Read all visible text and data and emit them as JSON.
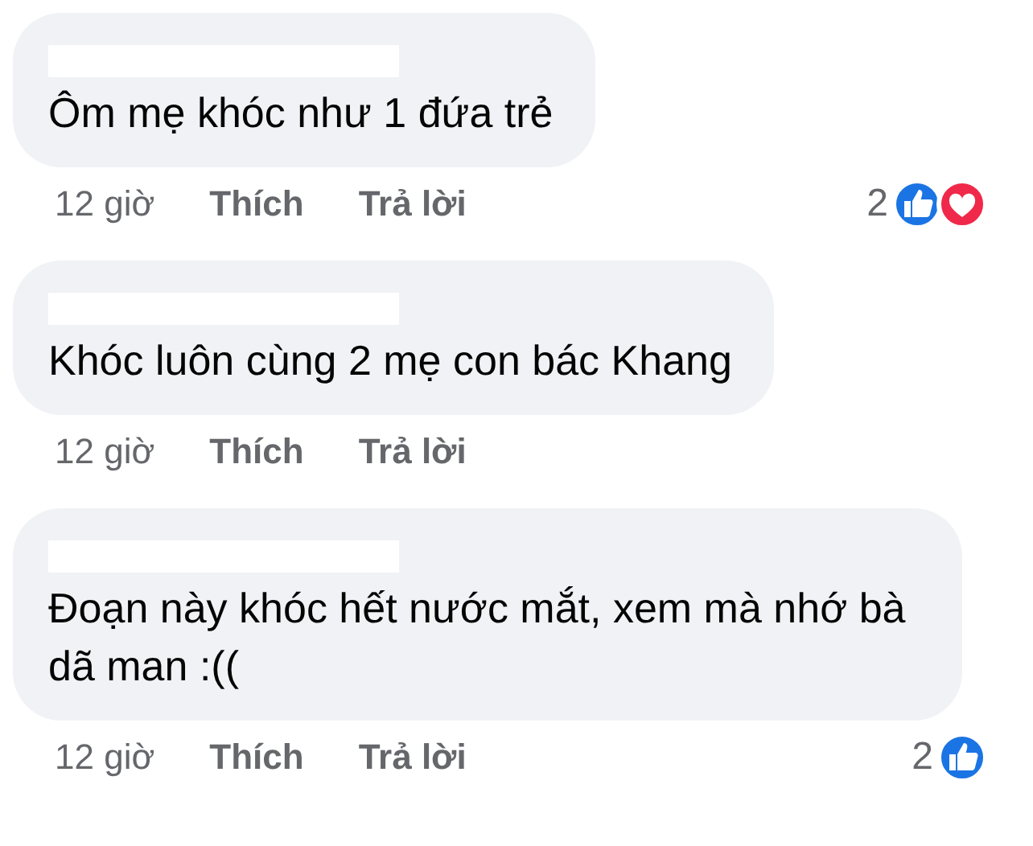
{
  "comments": [
    {
      "name_redacted": true,
      "text": "Ôm mẹ khóc như 1 đứa trẻ",
      "time": "12 giờ",
      "like_label": "Thích",
      "reply_label": "Trả lời",
      "reaction_count": "2",
      "reactions": [
        {
          "kind": "like"
        },
        {
          "kind": "love"
        }
      ]
    },
    {
      "name_redacted": true,
      "text": "Khóc luôn cùng 2 mẹ con bác Khang",
      "time": "12 giờ",
      "like_label": "Thích",
      "reply_label": "Trả lời"
    },
    {
      "name_redacted": true,
      "text": "Đoạn này khóc hết nước mắt, xem mà nhớ bà dã man :((",
      "time": "12 giờ",
      "like_label": "Thích",
      "reply_label": "Trả lời",
      "reaction_count": "2",
      "reactions": [
        {
          "kind": "like"
        }
      ]
    }
  ]
}
